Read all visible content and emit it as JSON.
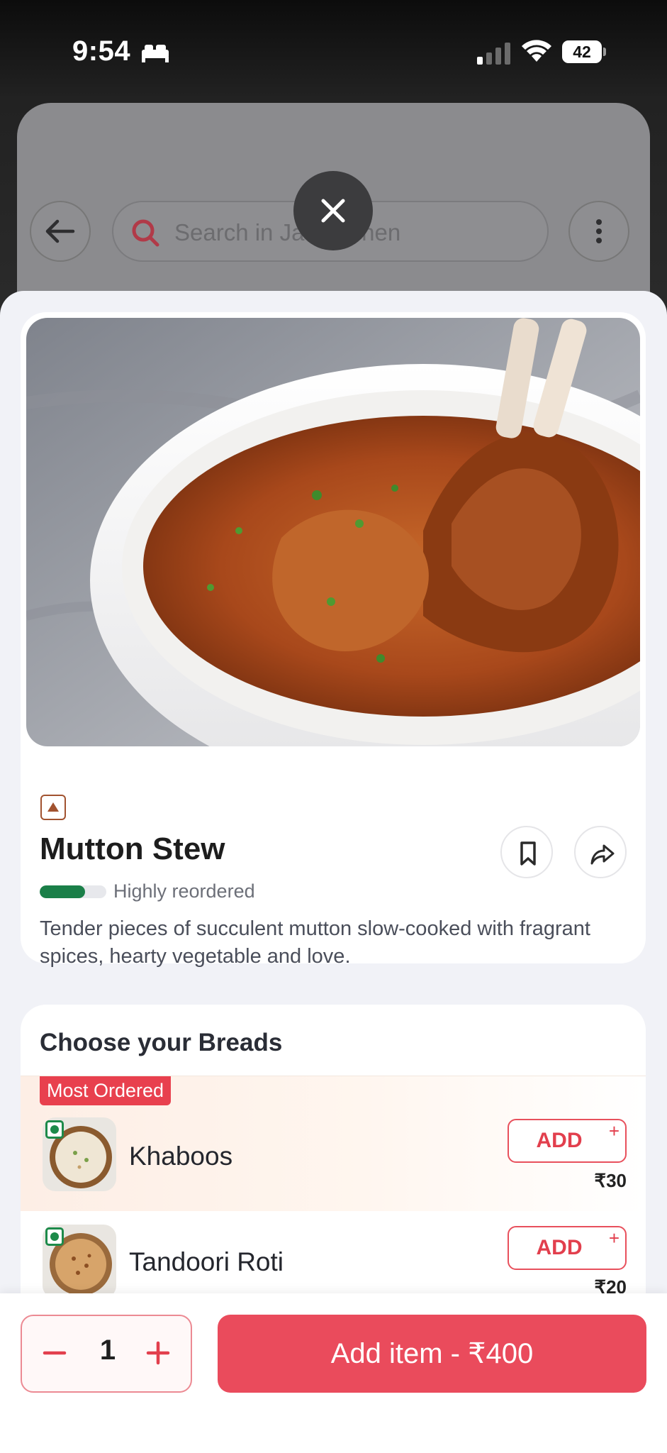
{
  "status_bar": {
    "time": "9:54",
    "battery": "42"
  },
  "background_page": {
    "search_placeholder": "Search in Jas Kitchen"
  },
  "dish": {
    "name": "Mutton Stew",
    "reorder_label": "Highly reordered",
    "reorder_level": 0.68,
    "description": "Tender pieces of succulent mutton slow-cooked with fragrant spices, hearty vegetable and love.",
    "food_type": "non-veg"
  },
  "breads": {
    "title": "Choose your Breads",
    "items": [
      {
        "badge": "Most Ordered",
        "name": "Khaboos",
        "price": "₹30",
        "add_label": "ADD",
        "add_plus": "+"
      },
      {
        "name": "Tandoori Roti",
        "price": "₹20",
        "add_label": "ADD",
        "add_plus": "+"
      }
    ]
  },
  "bottom_bar": {
    "quantity": "1",
    "add_item_label": "Add item - ₹400"
  },
  "colors": {
    "accent": "#ea4b5c",
    "veg_green": "#1d8a4a",
    "reorder_green": "#1a7f48"
  },
  "icons": [
    "bed-icon",
    "signal-icon",
    "wifi-icon",
    "battery-icon",
    "back-arrow-icon",
    "search-icon",
    "more-vertical-icon",
    "close-icon",
    "non-veg-icon",
    "bookmark-icon",
    "share-icon",
    "veg-icon",
    "minus-icon",
    "plus-icon"
  ]
}
